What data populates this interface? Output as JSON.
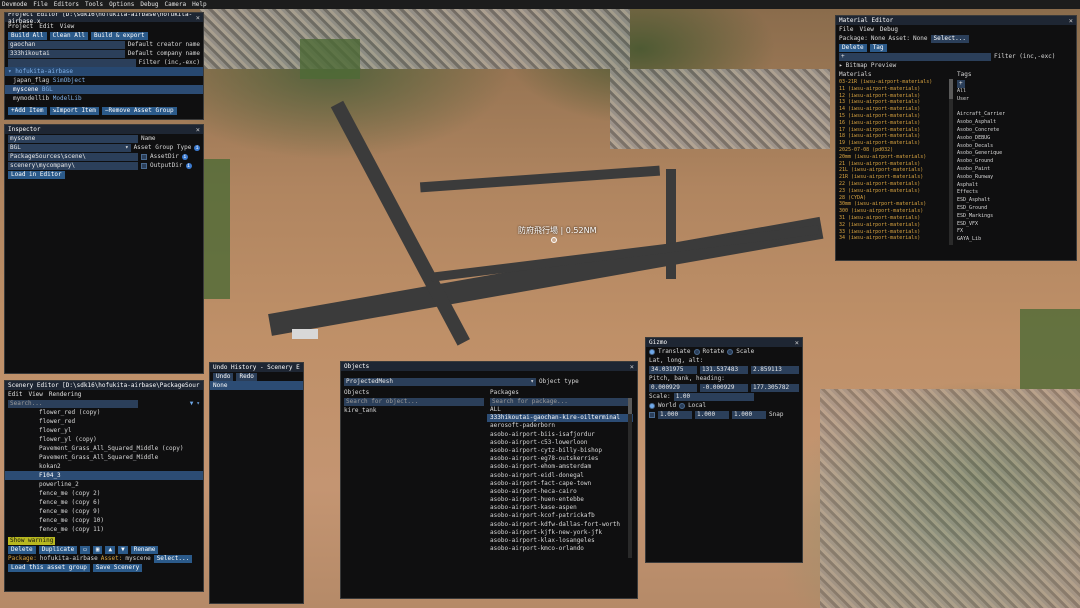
{
  "menubar": [
    "Devmode",
    "File",
    "Editors",
    "Tools",
    "Options",
    "Debug",
    "Camera",
    "Help"
  ],
  "scene_label": "防府飛行場 | 0.52NM",
  "project_editor": {
    "title": "Project Editor [D:\\sdk16\\hofukita-airbase\\hofukita-airbase.x",
    "menu": [
      "Project",
      "Edit",
      "View"
    ],
    "buttons": [
      "Build All",
      "Clean All",
      "Build & export"
    ],
    "fields": [
      {
        "value": "gaochan",
        "label": "Default creator name"
      },
      {
        "value": "333hikoutai",
        "label": "Default company name"
      },
      {
        "value": "",
        "label": "Filter (inc,-exc)"
      }
    ],
    "tree_root": "hofukita-airbase",
    "tree": [
      {
        "name": "japan_flag",
        "type": "SimObject"
      },
      {
        "name": "myscene",
        "type": "BGL"
      },
      {
        "name": "mymodellib",
        "type": "ModelLib"
      }
    ],
    "actions": [
      "Add Item",
      "Import Item",
      "Remove Asset Group"
    ]
  },
  "inspector": {
    "title": "Inspector",
    "rows": [
      {
        "value": "myscene",
        "label": "Name"
      },
      {
        "value": "BGL",
        "label": "Asset Group Type"
      },
      {
        "value": "PackageSources\\scene\\",
        "label": "AssetDir"
      },
      {
        "value": "scenery\\mycompany\\",
        "label": "OutputDir"
      }
    ],
    "load_button": "Load in Editor"
  },
  "scenery_editor": {
    "title": "Scenery Editor [D:\\sdk16\\hofukita-airbase\\PackageSources\\sc",
    "menu": [
      "Edit",
      "View",
      "Rendering"
    ],
    "search_placeholder": "Search...",
    "items": [
      "flower_red (copy)",
      "flower_red",
      "flower_yl",
      "flower_yl (copy)",
      "Pavement_Grass_All_Squared_Middle (copy)",
      "Pavement_Grass_All_Squared_Middle",
      "kokan2",
      "F104_3",
      "powerline_2",
      "fence_me (copy 2)",
      "fence_me (copy 6)",
      "fence_me (copy 9)",
      "fence_me (copy 10)",
      "fence_me (copy 11)"
    ],
    "selected_index": 7,
    "show_warning": "Show warning",
    "actions": [
      "Delete",
      "Duplicate",
      "Rename"
    ],
    "package_label": "Package:",
    "package_value": "hofukita-airbase",
    "asset_label": "Asset:",
    "asset_value": "myscene",
    "select_button": "Select...",
    "load_group": "Load this asset group",
    "save_scenery": "Save Scenery"
  },
  "undo_history": {
    "title": "Undo History - Scenery Ed",
    "buttons": [
      "Undo",
      "Redo"
    ],
    "items": [
      "None"
    ]
  },
  "objects": {
    "title": "Objects",
    "type_value": "ProjectedMesh",
    "type_label": "Object type",
    "objects_header": "Objects",
    "packages_header": "Packages",
    "search_objects": "Search for object...",
    "search_packages": "Search for package...",
    "objects": [
      "kire_tank"
    ],
    "packages": [
      "ALL",
      "333hikoutai-gaochan-kire-oilterminal",
      "aerosoft-paderborn",
      "asobo-airport-biis-isafjordur",
      "asobo-airport-c53-lowerloon",
      "asobo-airport-cytz-billy-bishop",
      "asobo-airport-eg78-outskerries",
      "asobo-airport-ehom-amsterdam",
      "asobo-airport-eidl-donegal",
      "asobo-airport-fact-cape-town",
      "asobo-airport-heca-cairo",
      "asobo-airport-huen-entebbe",
      "asobo-airport-kase-aspen",
      "asobo-airport-kcof-patrickafb",
      "asobo-airport-kdfw-dallas-fort-worth",
      "asobo-airport-kjfk-new-york-jfk",
      "asobo-airport-klax-losangeles",
      "asobo-airport-kmco-orlando"
    ],
    "selected_package": 1
  },
  "gizmo": {
    "title": "Gizmo",
    "modes": [
      "Translate",
      "Rotate",
      "Scale"
    ],
    "mode_selected": 0,
    "lla_label": "Lat, long, alt:",
    "lla": [
      "34.031975",
      "131.537483",
      "2.859113"
    ],
    "pbh_label": "Pitch, bank, heading:",
    "pbh": [
      "0.000929",
      "-0.000929",
      "177.305782"
    ],
    "scale_label": "Scale:",
    "scale_value": "1.00",
    "space": [
      "World",
      "Local"
    ],
    "space_selected": 0,
    "snap": [
      "1.000",
      "1.000",
      "1.000"
    ],
    "snap_label": "Snap"
  },
  "material_editor": {
    "title": "Material Editor",
    "menu": [
      "File",
      "View",
      "Debug"
    ],
    "package_label": "Package:",
    "package_value": "None",
    "asset_label": "Asset:",
    "asset_value": "None",
    "select_button": "Select...",
    "buttons": [
      "Delete",
      "Tag"
    ],
    "filter_label": "Filter (inc,-exc)",
    "bitmap_preview": "Bitmap Preview",
    "materials_header": "Materials",
    "tags_header": "Tags",
    "materials": [
      "03-21R (iwsu-airport-materials)",
      "11 (iwsu-airport-materials)",
      "12 (iwsu-airport-materials)",
      "13 (iwsu-airport-materials)",
      "14 (iwsu-airport-materials)",
      "15 (iwsu-airport-materials)",
      "16 (iwsu-airport-materials)",
      "17 (iwsu-airport-materials)",
      "18 (iwsu-airport-materials)",
      "19 (iwsu-airport-materials)",
      "2025-07-08 (pd032)",
      "20mm (iwsu-airport-materials)",
      "21 (iwsu-airport-materials)",
      "21L (iwsu-airport-materials)",
      "21R (iwsu-airport-materials)",
      "22 (iwsu-airport-materials)",
      "23 (iwsu-airport-materials)",
      "28 (CYDA)",
      "30mm (iwsu-airport-materials)",
      "300 (iwsu-airport-materials)",
      "31 (iwsu-airport-materials)",
      "32 (iwsu-airport-materials)",
      "33 (iwsu-airport-materials)",
      "34 (iwsu-airport-materials)"
    ],
    "tags": [
      "All",
      "User",
      "",
      "Aircraft_Carrier",
      "Asobo_Asphalt",
      "Asobo_Concrete",
      "Asobo_DEBUG",
      "Asobo_Decals",
      "Asobo_Generique",
      "Asobo_Ground",
      "Asobo_Paint",
      "Asobo_Runway",
      "Asphalt",
      "Effects",
      "ESD_Asphalt",
      "ESD_Ground",
      "ESD_Markings",
      "ESD_VFX",
      "FX",
      "GAYA_Lib"
    ]
  }
}
